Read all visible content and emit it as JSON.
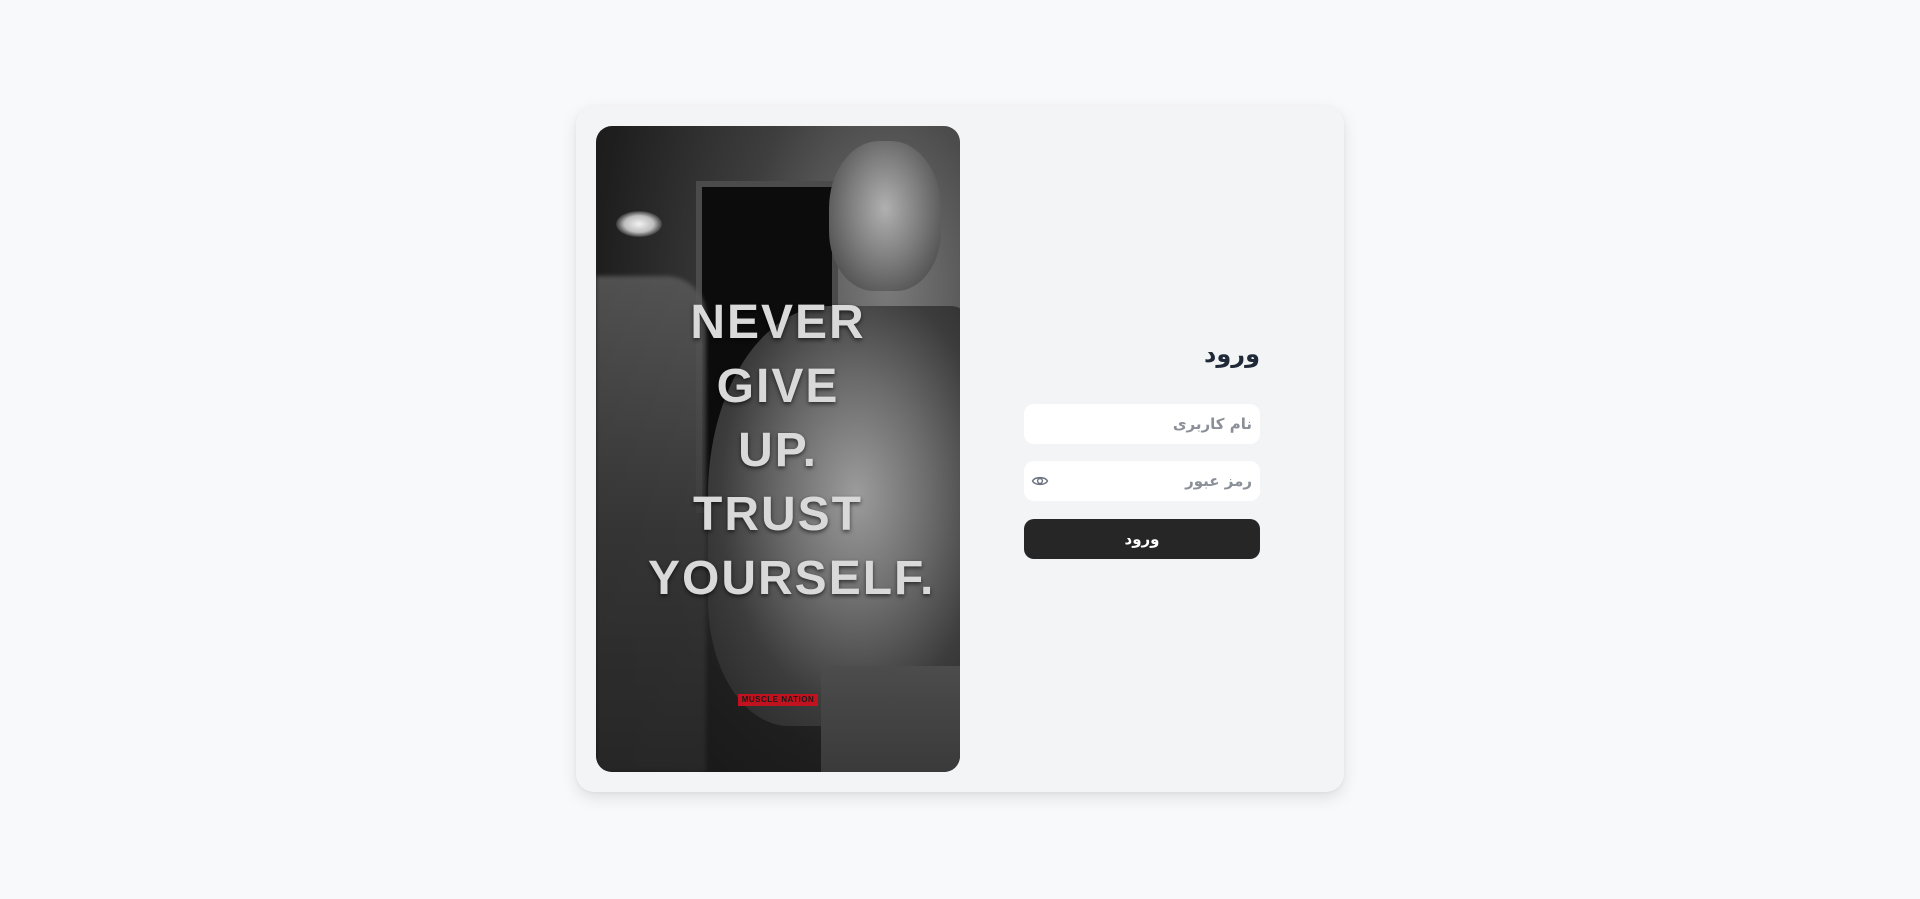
{
  "hero": {
    "quote_lines": [
      "NEVER",
      "GIVE",
      "UP.",
      "TRUST",
      "YOURSELF."
    ],
    "badge_text": "MUSCLE NATION"
  },
  "form": {
    "title": "ورود",
    "username": {
      "placeholder": "نام کاربری",
      "value": ""
    },
    "password": {
      "placeholder": "رمز عبور",
      "value": "",
      "toggle_icon": "eye-icon"
    },
    "submit_label": "ورود"
  },
  "colors": {
    "page_background": "#f8f9fb",
    "card_background": "#f3f4f6",
    "button_background": "#262626",
    "button_text": "#ffffff",
    "badge_red": "#c1121f"
  }
}
